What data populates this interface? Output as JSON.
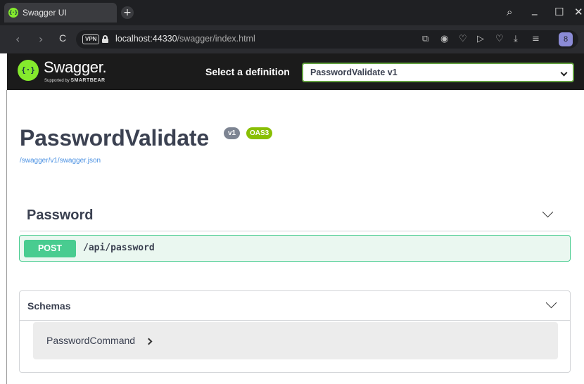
{
  "browser": {
    "tab_title": "Swagger UI",
    "favicon_glyph": "{···}",
    "new_tab_glyph": "+",
    "url_host": "localhost:44330",
    "url_path": "/swagger/index.html",
    "vpn_label": "VPN",
    "profile_glyph": "8",
    "nav_glyphs": {
      "back": "‹",
      "forward": "›",
      "reload": "C"
    },
    "window_glyphs": {
      "search": "⌕",
      "minimize": "_",
      "maximize": "☐",
      "close": "✕"
    },
    "toolbar_glyphs": {
      "share": "⧉",
      "camera": "◉",
      "shield": "♡",
      "play": "▷",
      "heart": "♡",
      "download": "⤓",
      "menu": "≡"
    }
  },
  "swagger": {
    "logo_mark": "{···}",
    "logo_text": "Swagger.",
    "logo_sub_prefix": "Supported by ",
    "logo_sub_brand": "SMARTBEAR",
    "select_label": "Select a definition",
    "selected_definition": "PasswordValidate v1",
    "accent_green": "#85ea2d"
  },
  "info": {
    "title": "PasswordValidate",
    "version_badge": "v1",
    "oas_badge": "OAS3",
    "spec_link": "/swagger/v1/swagger.json"
  },
  "tags": [
    {
      "name": "Password",
      "operations": [
        {
          "method": "POST",
          "path": "/api/password",
          "color": "#49cc90"
        }
      ]
    }
  ],
  "schemas": {
    "title": "Schemas",
    "models": [
      {
        "name": "PasswordCommand"
      }
    ]
  }
}
